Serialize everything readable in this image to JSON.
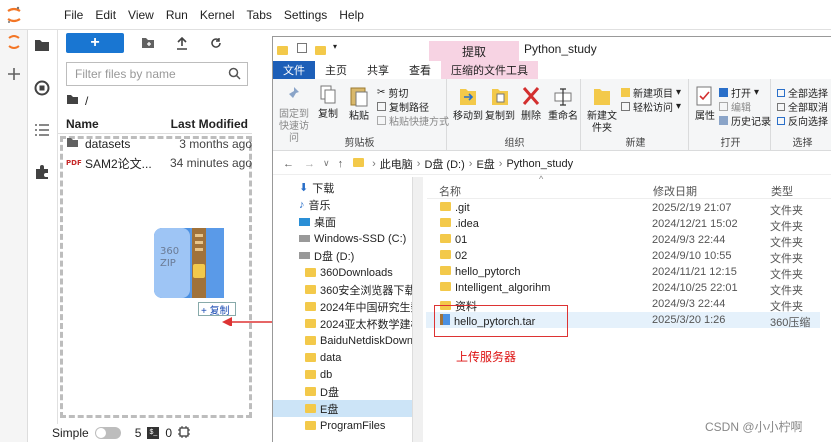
{
  "jupyter": {
    "menu": [
      "File",
      "Edit",
      "View",
      "Run",
      "Kernel",
      "Tabs",
      "Settings",
      "Help"
    ],
    "new_button": "+",
    "search_placeholder": "Filter files by name",
    "breadcrumb": "/",
    "columns": {
      "name": "Name",
      "modified": "Last Modified"
    },
    "files": [
      {
        "name": "datasets",
        "modified": "3 months ago",
        "icon": "folder-icon"
      },
      {
        "name": "SAM2论文...",
        "modified": "34 minutes ago",
        "icon": "pdf-icon"
      }
    ],
    "status": {
      "mode": "Simple",
      "count1": "5",
      "count2": "0"
    },
    "drag_copy_label": "+ 复制"
  },
  "explorer": {
    "title": "Python_study",
    "context_tab": "提取",
    "ribbon_tabs": [
      "文件",
      "主页",
      "共享",
      "查看",
      "压缩的文件工具"
    ],
    "groups": {
      "clipboard": {
        "label": "剪贴板",
        "pin": "固定到快速访问",
        "copy": "复制",
        "paste": "粘贴",
        "cut": "剪切",
        "copy_path": "复制路径",
        "paste_shortcut": "粘贴快捷方式"
      },
      "organize": {
        "label": "组织",
        "move": "移动到",
        "copy_to": "复制到",
        "delete": "删除",
        "rename": "重命名"
      },
      "new": {
        "label": "新建",
        "new_folder": "新建文件夹",
        "new_item": "新建项目",
        "easy_access": "轻松访问"
      },
      "open": {
        "label": "打开",
        "properties": "属性",
        "open": "打开",
        "edit": "编辑",
        "history": "历史记录"
      },
      "select": {
        "label": "选择",
        "select_all": "全部选择",
        "select_none": "全部取消",
        "invert": "反向选择"
      }
    },
    "path": [
      "此电脑",
      "D盘 (D:)",
      "E盘",
      "Python_study"
    ],
    "nav": [
      {
        "label": "下载",
        "sel": false
      },
      {
        "label": "音乐",
        "sel": false
      },
      {
        "label": "桌面",
        "sel": false
      },
      {
        "label": "Windows-SSD (C:)",
        "sel": false
      },
      {
        "label": "D盘 (D:)",
        "sel": false
      },
      {
        "label": "360Downloads",
        "sel": false
      },
      {
        "label": "360安全浏览器下载",
        "sel": false
      },
      {
        "label": "2024年中国研究生数学建",
        "sel": false
      },
      {
        "label": "2024亚太杯数学建模",
        "sel": false
      },
      {
        "label": "BaiduNetdiskDownload",
        "sel": false
      },
      {
        "label": "data",
        "sel": false
      },
      {
        "label": "db",
        "sel": false
      },
      {
        "label": "D盘",
        "sel": false
      },
      {
        "label": "E盘",
        "sel": true
      },
      {
        "label": "ProgramFiles",
        "sel": false
      }
    ],
    "list_columns": {
      "name": "名称",
      "date": "修改日期",
      "type": "类型"
    },
    "items": [
      {
        "name": ".git",
        "date": "2025/2/19 21:07",
        "type": "文件夹",
        "kind": "folder"
      },
      {
        "name": ".idea",
        "date": "2024/12/21 15:02",
        "type": "文件夹",
        "kind": "folder"
      },
      {
        "name": "01",
        "date": "2024/9/3 22:44",
        "type": "文件夹",
        "kind": "folder"
      },
      {
        "name": "02",
        "date": "2024/9/10 10:55",
        "type": "文件夹",
        "kind": "folder"
      },
      {
        "name": "hello_pytorch",
        "date": "2024/11/21 12:15",
        "type": "文件夹",
        "kind": "folder"
      },
      {
        "name": "Intelligent_algorihm",
        "date": "2024/10/25 22:01",
        "type": "文件夹",
        "kind": "folder"
      },
      {
        "name": "资料",
        "date": "2024/9/3 22:44",
        "type": "文件夹",
        "kind": "folder"
      },
      {
        "name": "hello_pytorch.tar",
        "date": "2025/3/20 1:26",
        "type": "360压缩",
        "kind": "archive"
      }
    ],
    "annotation": "上传服务器"
  },
  "watermark": "CSDN @小小柠啊"
}
